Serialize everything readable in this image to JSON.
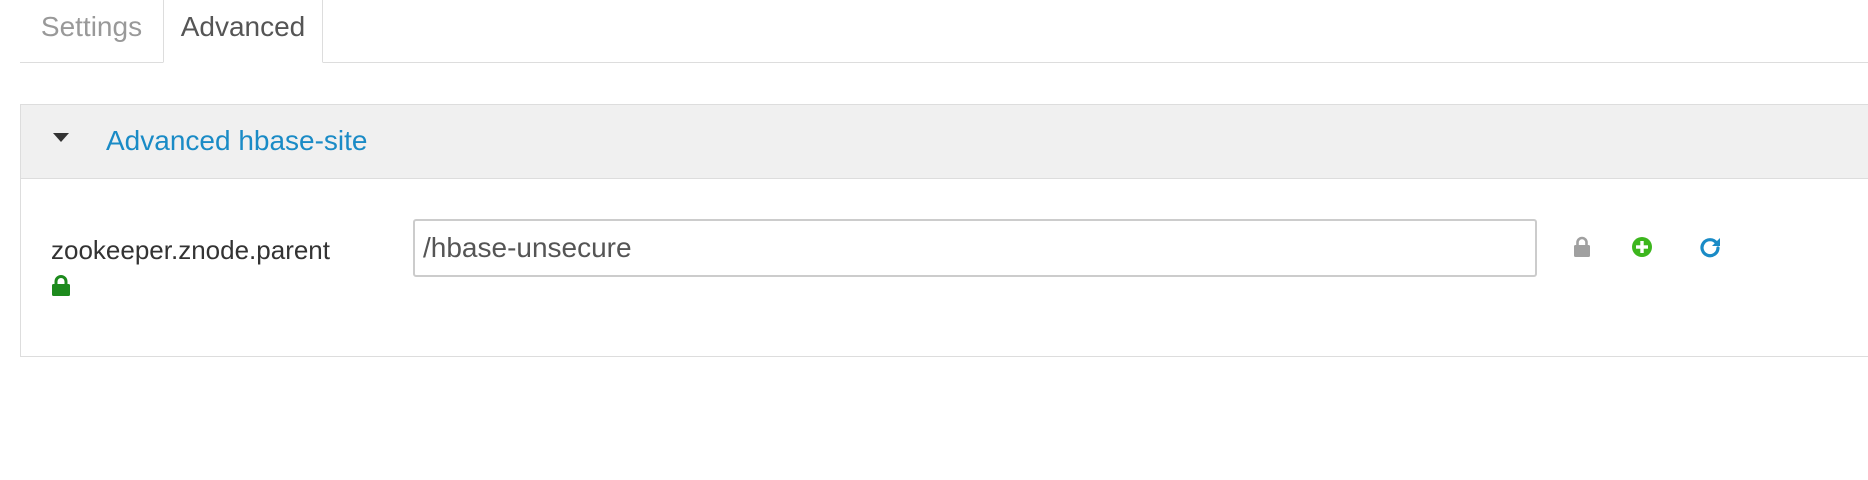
{
  "tabs": [
    {
      "label": "Settings",
      "active": false
    },
    {
      "label": "Advanced",
      "active": true
    }
  ],
  "panel": {
    "title": "Advanced hbase-site",
    "expanded": true,
    "property": {
      "name": "zookeeper.znode.parent",
      "value": "/hbase-unsecure",
      "name_icon": "lock-icon",
      "actions": [
        "lock-icon",
        "add-icon",
        "refresh-icon"
      ]
    }
  },
  "colors": {
    "link_blue": "#1a8bc6",
    "success_green": "#3cb61d",
    "lock_green": "#1d8a1d",
    "muted_grey": "#a0a0a0",
    "heading_bg": "#f0f0f0"
  }
}
